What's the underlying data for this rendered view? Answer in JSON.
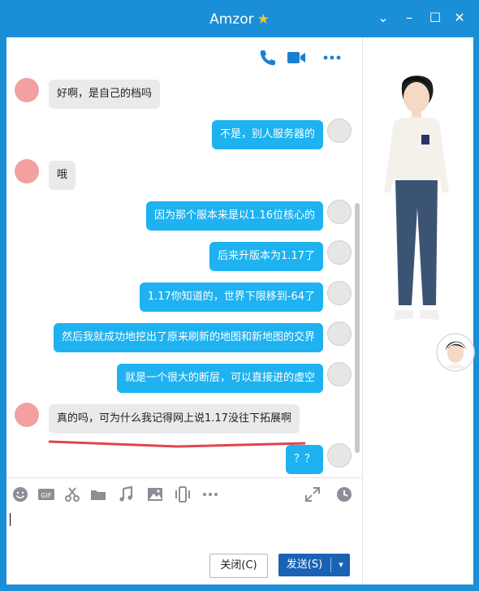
{
  "window": {
    "title": "Amzor",
    "title_icon": "star-icon",
    "colors": {
      "titlebar": "#1a8fd8",
      "bubble_sent": "#1eb2f0",
      "bubble_received": "#e9eaec",
      "send_button": "#1a62b4",
      "underline": "#e0454f"
    }
  },
  "header_actions": {
    "voice_call_icon": "phone-icon",
    "video_call_icon": "video-icon",
    "more_icon": "more-icon"
  },
  "messages": [
    {
      "side": "left",
      "text": "好啊，是自己的档吗"
    },
    {
      "side": "right",
      "text": "不是，别人服务器的"
    },
    {
      "side": "left",
      "text": "哦"
    },
    {
      "side": "right",
      "text": "因为那个服本来是以1.16位核心的"
    },
    {
      "side": "right",
      "text": "后来升版本为1.17了"
    },
    {
      "side": "right",
      "text": "1.17你知道的，世界下限移到-64了"
    },
    {
      "side": "right",
      "text": "然后我就成功地挖出了原来刷新的地图和新地图的交界"
    },
    {
      "side": "right",
      "text": "就是一个很大的断层，可以直接进的虚空"
    },
    {
      "side": "left",
      "text": "真的吗，可为什么我记得网上说1.17没往下拓展啊"
    },
    {
      "side": "right",
      "text": "？？"
    }
  ],
  "tools": [
    "emoji-icon",
    "gif-icon",
    "scissors-icon",
    "folder-icon",
    "music-icon",
    "image-icon",
    "shake-icon",
    "more-icon",
    "expand-icon",
    "history-icon"
  ],
  "input": {
    "value": ""
  },
  "buttons": {
    "close_label": "关闭(C)",
    "send_label": "发送(S)",
    "send_dropdown": "▾"
  }
}
